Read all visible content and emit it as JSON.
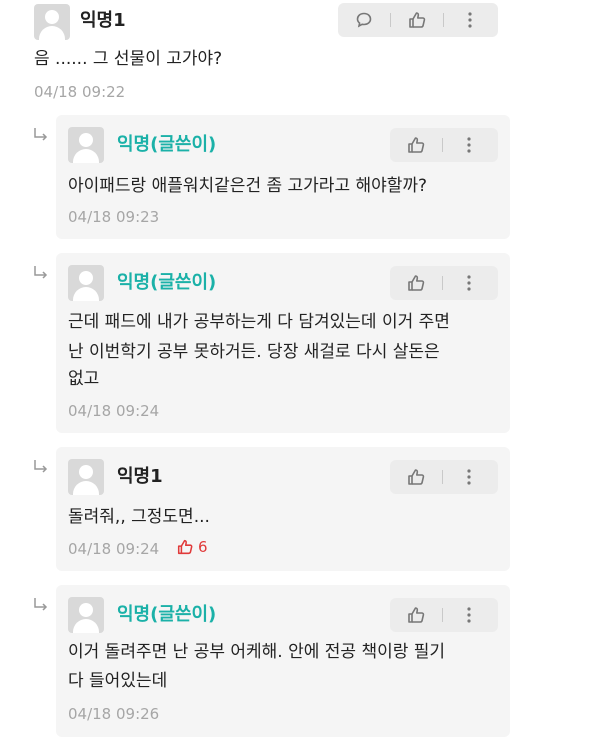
{
  "comment": {
    "author": "익명1",
    "text": "음 ...... 그 선물이 고가야?",
    "time": "04/18 09:22"
  },
  "replies": [
    {
      "author": "익명(글쓴이)",
      "lines": [
        "아이패드랑 애플워치같은건 좀 고가라고 해야할까?"
      ],
      "time": "04/18 09:23"
    },
    {
      "author": "익명(글쓴이)",
      "lines": [
        "근데 패드에 내가 공부하는게 다 담겨있는데 이거 주면",
        "난 이번학기 공부 못하거든. 당장 새걸로 다시 살돈은",
        "없고"
      ],
      "time": "04/18 09:24"
    },
    {
      "author": "익명1",
      "lines": [
        "돌려줘,, 그정도면..."
      ],
      "time": "04/18 09:24",
      "likes": "6"
    },
    {
      "author": "익명(글쓴이)",
      "lines": [
        "이거 돌려주면 난 공부 어케해. 안에 전공 책이랑 필기",
        "다 들어있는데"
      ],
      "time": "04/18 09:26"
    }
  ],
  "colors": {
    "author_accent": "#1bb1a8",
    "like": "#e03a3a"
  }
}
